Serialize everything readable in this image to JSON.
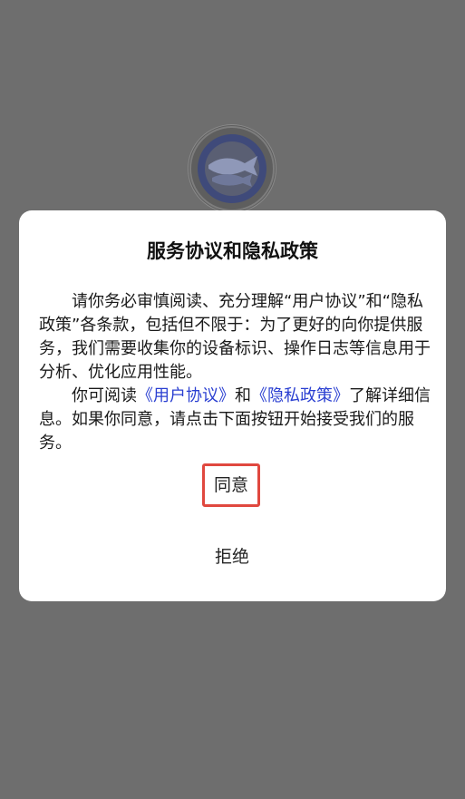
{
  "background": {
    "color": "#6e6e6e"
  },
  "logo": {
    "icon": "fish-logo-icon",
    "accent": "#4a57a8"
  },
  "dialog": {
    "title": "服务协议和隐私政策",
    "paragraph1": "请你务必审慎阅读、充分理解“用户协议”和“隐私政策”各条款，包括但不限于：为了更好的向你提供服务，我们需要收集你的设备标识、操作日志等信息用于分析、优化应用性能。",
    "paragraph2_prefix": "你可阅读",
    "user_agreement_link": "《用户协议》",
    "paragraph2_and": "和",
    "privacy_policy_link": "《隐私政策》",
    "paragraph2_suffix": "了解详细信息。如果你同意，请点击下面按钮开始接受我们的服务。",
    "agree_label": "同意",
    "reject_label": "拒绝",
    "link_color": "#2a3fd1",
    "highlight_color": "#e0483f"
  }
}
